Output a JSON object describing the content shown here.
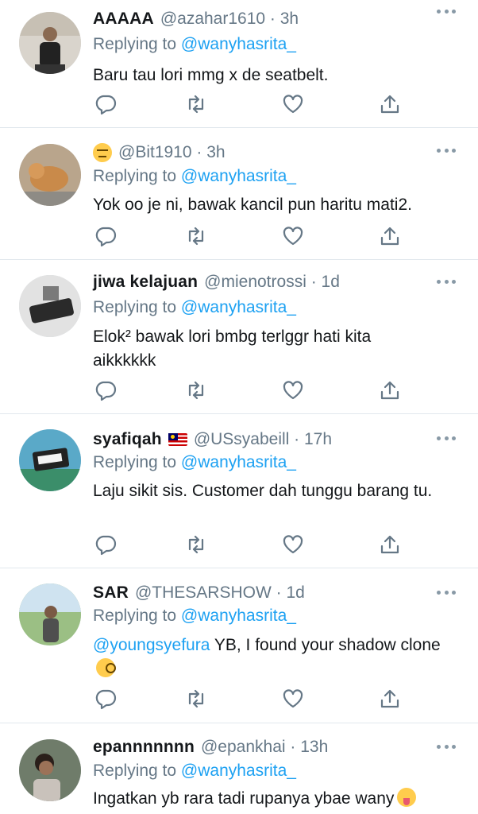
{
  "replying_prefix": "Replying to",
  "tweets": [
    {
      "name": "AAAAA",
      "meta": "@azahar1610 · 3h",
      "reply_to": "@wanyhasrita_",
      "text": "Baru tau lori mmg x de seatbelt."
    },
    {
      "name": "",
      "meta": "@Bit1910 · 3h",
      "reply_to": "@wanyhasrita_",
      "text": "Yok oo je ni, bawak kancil pun haritu mati2.",
      "name_icon": "expressionless-face-emoji"
    },
    {
      "name": "jiwa kelajuan",
      "meta": "@mienotrossi · 1d",
      "reply_to": "@wanyhasrita_",
      "text": "Elok² bawak lori bmbg terlggr hati kita aikkkkkk"
    },
    {
      "name": "syafiqah",
      "meta": "@USsyabeill · 17h",
      "reply_to": "@wanyhasrita_",
      "text": "Laju sikit sis. Customer dah tunggu barang tu.",
      "name_icon": "malaysia-flag-emoji"
    },
    {
      "name": "SAR",
      "meta": "@THESARSHOW · 1d",
      "reply_to": "@wanyhasrita_",
      "mention": "@youngsyefura",
      "text": " YB, I found your shadow clone",
      "text_emoji": "face-with-monocle-emoji"
    },
    {
      "name": "epannnnnnn",
      "meta": "@epankhai · 13h",
      "reply_to": "@wanyhasrita_",
      "text": "Ingatkan yb rara tadi rupanya ybae wany",
      "text_emoji": "squinting-tongue-face-emoji"
    }
  ],
  "colors": {
    "link": "#1da1f2",
    "secondary_text": "#657786",
    "divider": "#e1e8ed",
    "icon": "#657786"
  },
  "icons": [
    "more-icon",
    "reply-icon",
    "retweet-icon",
    "like-icon",
    "share-icon"
  ]
}
